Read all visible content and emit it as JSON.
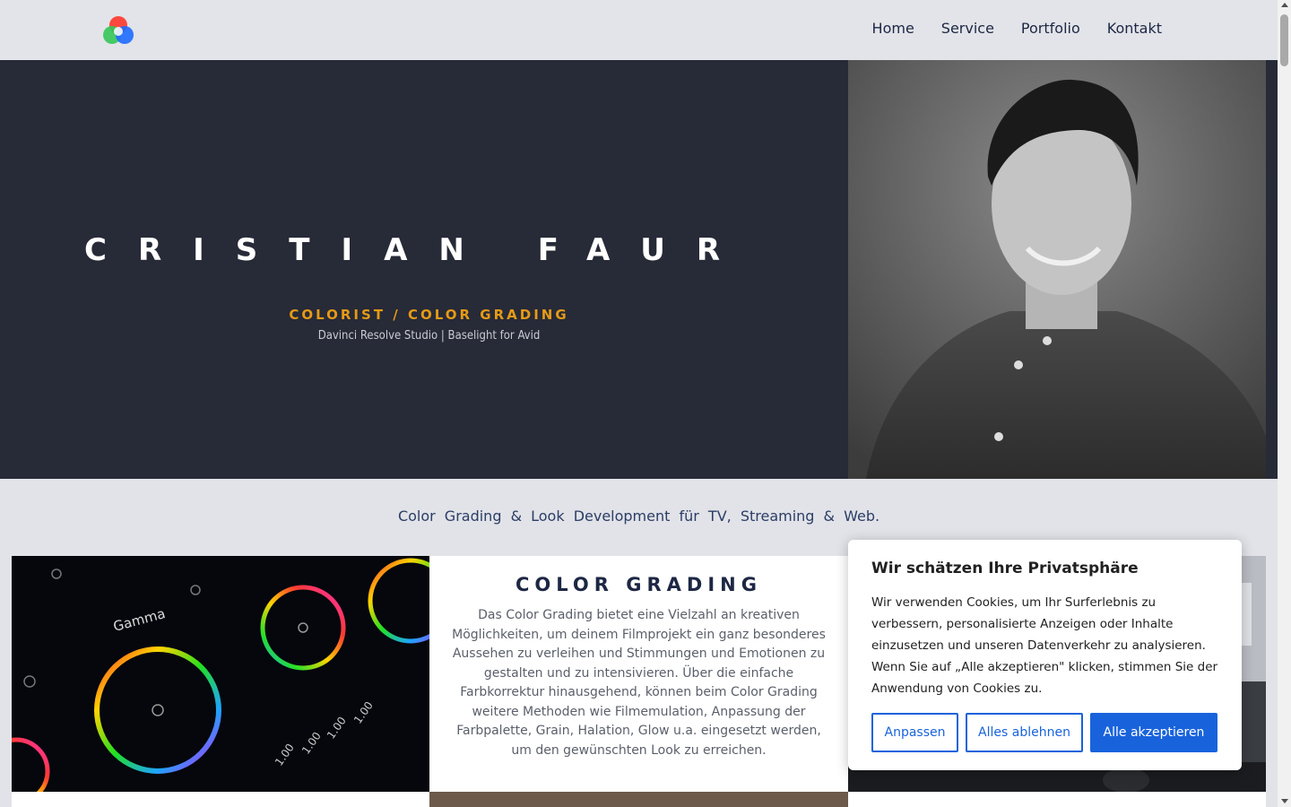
{
  "header": {
    "logo_name": "rgb-circles-logo",
    "nav": [
      {
        "label": "Home"
      },
      {
        "label": "Service"
      },
      {
        "label": "Portfolio"
      },
      {
        "label": "Kontakt"
      }
    ]
  },
  "hero": {
    "name": "CRISTIAN FAUR",
    "role": "COLORIST / COLOR GRADING",
    "tools": "Davinci Resolve Studio | Baselight for Avid"
  },
  "tagline": "Color Grading & Look Development für TV, Streaming & Web.",
  "services": {
    "card": {
      "title": "COLOR GRADING",
      "text": "Das Color Grading bietet eine Vielzahl an kreativen Möglichkeiten, um deinem Filmprojekt ein ganz besonderes Aussehen zu verleihen und Stimmungen und Emotionen zu gestalten und zu intensivieren. Über die einfache Farbkorrektur hinausgehend, können beim Color Grading weitere Methoden wie Filmemulation, Anpassung der Farbpalette, Grain, Halation, Glow u.a. eingesetzt werden, um den gewünschten Look zu erreichen."
    },
    "image1_labels": {
      "gamma": "Gamma",
      "values": [
        "1.00",
        "1.00",
        "1.00",
        "1.00"
      ]
    }
  },
  "cookie": {
    "title": "Wir schätzen Ihre Privatsphäre",
    "text": "Wir verwenden Cookies, um Ihr Surferlebnis zu verbessern, personalisierte Anzeigen oder Inhalte einzusetzen und unseren Datenverkehr zu analysieren. Wenn Sie auf „Alle akzeptieren\" klicken, stimmen Sie der Anwendung von Cookies zu.",
    "buttons": {
      "customize": "Anpassen",
      "reject": "Alles ablehnen",
      "accept": "Alle akzeptieren"
    }
  },
  "colors": {
    "hero_bg": "#272a37",
    "accent_orange": "#e59a16",
    "navy": "#1d2744",
    "cookie_blue": "#1863dc"
  }
}
